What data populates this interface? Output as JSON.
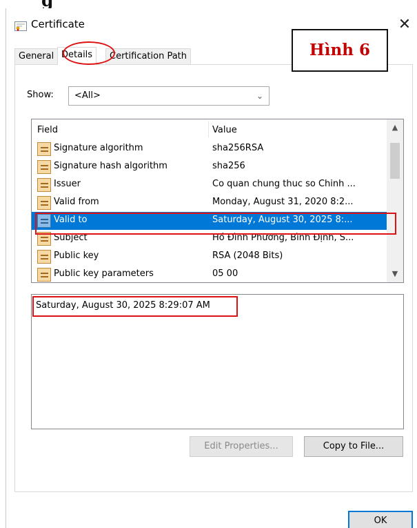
{
  "document": {
    "caption_fragment": "g"
  },
  "window": {
    "title": "Certificate",
    "close_glyph": "✕",
    "icon": "certificate-icon"
  },
  "tabs": [
    {
      "label": "General",
      "active": false
    },
    {
      "label": "Details",
      "active": true
    },
    {
      "label": "Certification Path",
      "active": false
    }
  ],
  "figure_label": "Hình 6",
  "show": {
    "label": "Show:",
    "selected": "<All>"
  },
  "list": {
    "columns": {
      "field": "Field",
      "value": "Value"
    },
    "rows": [
      {
        "field": "Signature algorithm",
        "value": "sha256RSA"
      },
      {
        "field": "Signature hash algorithm",
        "value": "sha256"
      },
      {
        "field": "Issuer",
        "value": "Co quan chung thuc so Chinh ..."
      },
      {
        "field": "Valid from",
        "value": "Monday, August 31, 2020 8:2..."
      },
      {
        "field": "Valid to",
        "value": "Saturday, August 30, 2025 8:...",
        "selected": true
      },
      {
        "field": "Subject",
        "value": "Hồ Đình Phương, Bình Định, S..."
      },
      {
        "field": "Public key",
        "value": "RSA (2048 Bits)"
      },
      {
        "field": "Public key parameters",
        "value": "05 00"
      }
    ]
  },
  "detail": {
    "value": "Saturday, August 30, 2025 8:29:07 AM"
  },
  "buttons": {
    "edit_properties": "Edit Properties...",
    "copy_to_file": "Copy to File...",
    "ok": "OK"
  },
  "colors": {
    "selection": "#0078d7",
    "annotation": "#dd1111",
    "figure_label_text": "#c40000"
  }
}
